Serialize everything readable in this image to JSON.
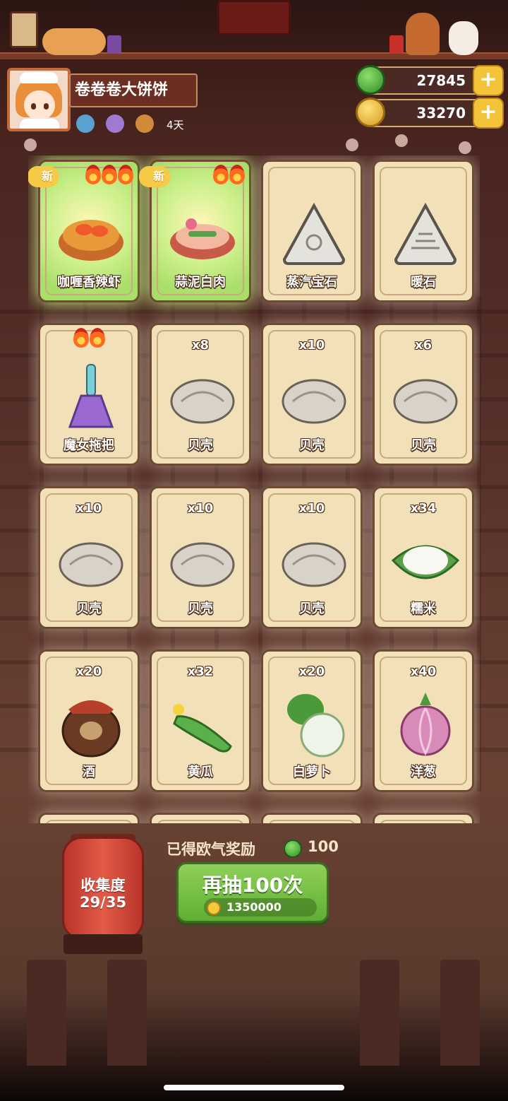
{
  "player": {
    "name": "卷卷卷大饼饼",
    "days": "4天"
  },
  "currency": {
    "jade": "27845",
    "coins": "33270",
    "plus": "+"
  },
  "cards": [
    {
      "label": "咖喱香辣虾",
      "new": "新",
      "flames": 3,
      "highlight": true
    },
    {
      "label": "蒜泥白肉",
      "new": "新",
      "flames": 2,
      "highlight": true
    },
    {
      "label": "蒸汽宝石",
      "highlight": false
    },
    {
      "label": "暖石",
      "highlight": false
    },
    {
      "label": "魔女拖把",
      "flames": 2,
      "highlight": false
    },
    {
      "label": "贝壳",
      "count": "x8"
    },
    {
      "label": "贝壳",
      "count": "x10"
    },
    {
      "label": "贝壳",
      "count": "x6"
    },
    {
      "label": "贝壳",
      "count": "x10"
    },
    {
      "label": "贝壳",
      "count": "x10"
    },
    {
      "label": "贝壳",
      "count": "x10"
    },
    {
      "label": "糯米",
      "count": "x34"
    },
    {
      "label": "酒",
      "count": "x20"
    },
    {
      "label": "黄瓜",
      "count": "x32"
    },
    {
      "label": "白萝卜",
      "count": "x20"
    },
    {
      "label": "洋葱",
      "count": "x40"
    }
  ],
  "bottom": {
    "reward_text": "已得欧气奖励",
    "reward_value": "100",
    "collection_title": "收集度",
    "collection_value": "29/35",
    "draw_label": "再抽100次",
    "draw_cost": "1350000"
  },
  "icons": {
    "jade": "jade-icon",
    "coin": "coin-icon"
  }
}
